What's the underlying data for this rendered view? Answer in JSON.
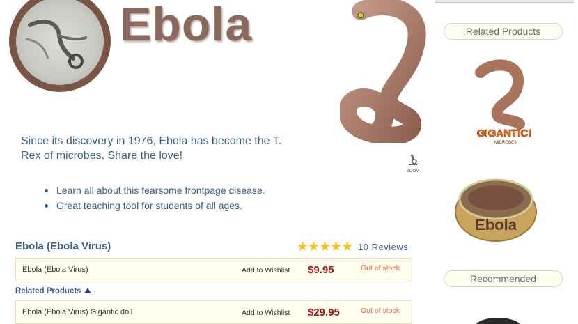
{
  "header": {
    "title": "Ebola",
    "zoom_label": "ZOOM"
  },
  "description": {
    "blurb": "Since its discovery in 1976, Ebola has become the T. Rex of microbes. Share the love!",
    "bullets": [
      "Learn all about this fearsome frontpage disease.",
      "Great teaching tool for students of all ages."
    ]
  },
  "product": {
    "name": "Ebola (Ebola Virus)",
    "rating": 5,
    "reviews_label": "10 Reviews",
    "star_color": "#f6c11a"
  },
  "variants": [
    {
      "name": "Ebola (Ebola Virus)",
      "wishlist": "Add to Wishlist",
      "price": "$9.95",
      "stock": "Out of stock"
    },
    {
      "name": "Ebola (Ebola Virus) Gigantic doll",
      "wishlist": "Add to Wishlist",
      "price": "$29.95",
      "stock": "Out of stock"
    }
  ],
  "related_toggle": "Related Products",
  "sidebar": {
    "related_heading": "Related Products",
    "recommended_heading": "Recommended",
    "gigantic_badge": "GIGANTIC!",
    "gigantic_sub": "MICROBES",
    "petri_label": "Ebola"
  },
  "colors": {
    "link": "#3b5f88",
    "price": "#a31a1a",
    "stock": "#e06a3a",
    "title": "#8a6a5e"
  }
}
